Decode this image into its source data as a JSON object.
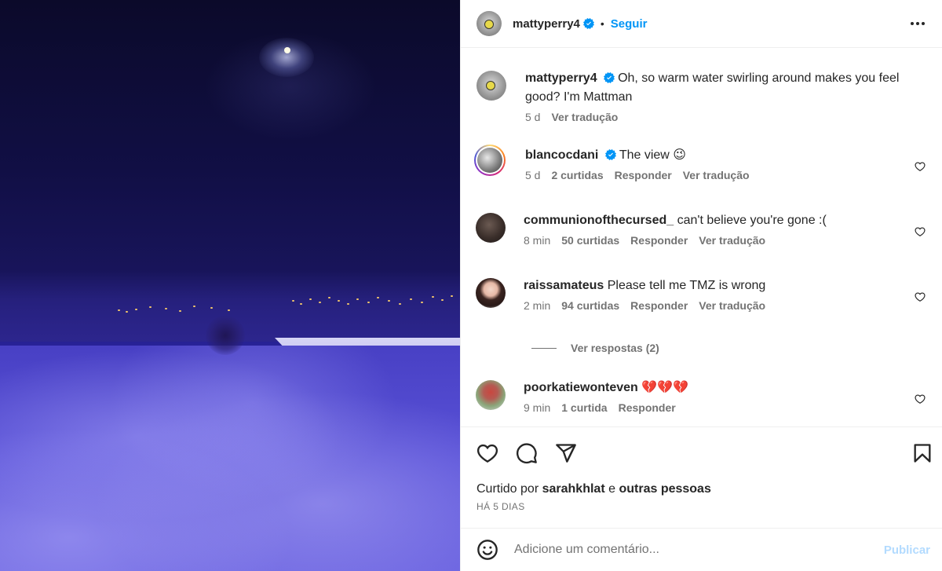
{
  "post": {
    "author": "mattyperry4",
    "follow_label": "Seguir",
    "caption_author": "mattyperry4",
    "caption_text": "Oh, so warm water swirling around makes you feel good? I'm Mattman",
    "caption_time": "5 d",
    "caption_translate": "Ver tradução"
  },
  "comments": [
    {
      "user": "blancocdani",
      "verified": true,
      "text": "The view 😉",
      "time": "5 d",
      "likes": "2 curtidas",
      "reply": "Responder",
      "translate": "Ver tradução"
    },
    {
      "user": "communionofthecursed_",
      "verified": false,
      "text": "can't believe you're gone :(",
      "time": "8 min",
      "likes": "50 curtidas",
      "reply": "Responder",
      "translate": "Ver tradução"
    },
    {
      "user": "raissamateus",
      "verified": false,
      "text": "Please tell me TMZ is wrong",
      "time": "2 min",
      "likes": "94 curtidas",
      "reply": "Responder",
      "translate": "Ver tradução"
    },
    {
      "user": "poorkatiewonteven",
      "verified": false,
      "text": "💔💔💔",
      "time": "9 min",
      "likes": "1 curtida",
      "reply": "Responder"
    }
  ],
  "view_replies": "Ver respostas (2)",
  "likes_line": {
    "prefix": "Curtido por",
    "user": "sarahkhlat",
    "joiner": "e",
    "others": "outras pessoas"
  },
  "date_label": "HÁ 5 DIAS",
  "add_comment": {
    "placeholder": "Adicione um comentário...",
    "post_label": "Publicar"
  },
  "colors": {
    "accent": "#0095f6",
    "verified": "#0095f6",
    "post_disabled": "#b3dbff"
  },
  "icons": [
    "heart-icon",
    "comment-icon",
    "share-icon",
    "bookmark-icon",
    "emoji-icon",
    "more-icon",
    "verified-icon"
  ]
}
